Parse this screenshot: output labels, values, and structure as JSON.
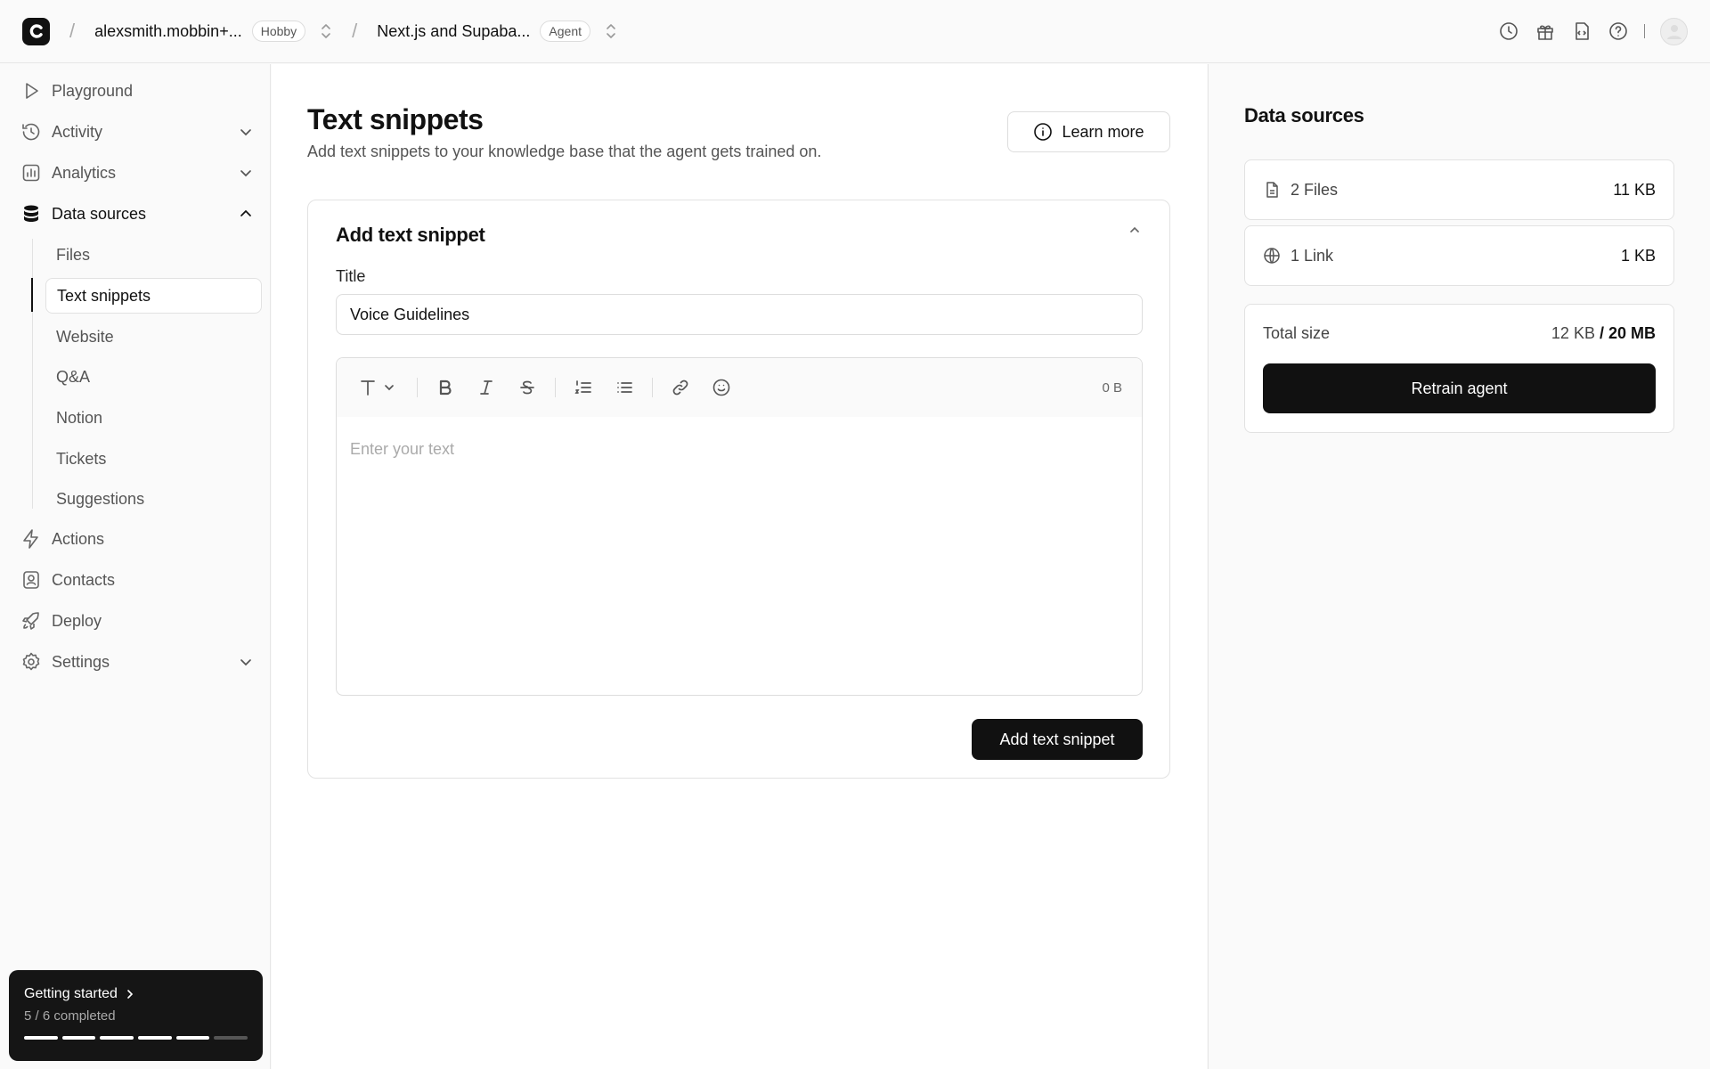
{
  "header": {
    "workspace": "alexsmith.mobbin+...",
    "workspace_plan": "Hobby",
    "agent": "Next.js and Supaba...",
    "agent_badge": "Agent"
  },
  "sidebar": {
    "items": [
      {
        "label": "Playground",
        "icon": "play-icon"
      },
      {
        "label": "Activity",
        "icon": "history-icon"
      },
      {
        "label": "Analytics",
        "icon": "chart-icon"
      },
      {
        "label": "Data sources",
        "icon": "database-icon"
      },
      {
        "label": "Actions",
        "icon": "bolt-icon"
      },
      {
        "label": "Contacts",
        "icon": "contacts-icon"
      },
      {
        "label": "Deploy",
        "icon": "rocket-icon"
      },
      {
        "label": "Settings",
        "icon": "gear-icon"
      }
    ],
    "data_sources_sub": [
      "Files",
      "Text snippets",
      "Website",
      "Q&A",
      "Notion",
      "Tickets",
      "Suggestions"
    ],
    "active_sub": "Text snippets"
  },
  "getting_started": {
    "title": "Getting started",
    "progress_text": "5 / 6 completed",
    "completed": 5,
    "total": 6
  },
  "main": {
    "title": "Text snippets",
    "subtitle": "Add text snippets to your knowledge base that the agent gets trained on.",
    "learn_more": "Learn more",
    "card": {
      "title": "Add text snippet",
      "title_label": "Title",
      "title_value": "Voice Guidelines",
      "size": "0 B",
      "editor_placeholder": "Enter your text",
      "submit": "Add text snippet"
    }
  },
  "right_panel": {
    "title": "Data sources",
    "sources": [
      {
        "label": "2 Files",
        "value": "11 KB",
        "icon": "file-icon"
      },
      {
        "label": "1 Link",
        "value": "1 KB",
        "icon": "globe-icon"
      }
    ],
    "total_label": "Total size",
    "total_used": "12 KB",
    "total_sep": " / ",
    "total_max": "20 MB",
    "retrain": "Retrain agent"
  }
}
